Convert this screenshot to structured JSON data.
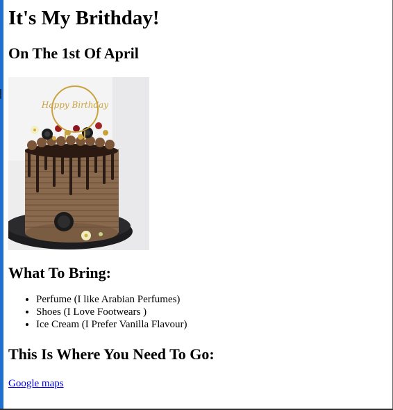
{
  "page": {
    "title": "It's My Brithday!",
    "subtitle": "On The 1st Of April",
    "cake_image": {
      "alt": "",
      "topper_text": "Happy Birthday"
    },
    "bring_heading": "What To Bring:",
    "bring_items": [
      "Perfume (I like Arabian Perfumes)",
      "Shoes (I Love Footwears )",
      "Ice Cream (I Prefer Vanilla Flavour)"
    ],
    "go_heading": "This Is Where You Need To Go:",
    "maps_link": "Google maps"
  },
  "colors": {
    "link": "#0000ee",
    "text": "#000000",
    "background": "#ffffff",
    "left_edge": "#1f6fd1"
  }
}
